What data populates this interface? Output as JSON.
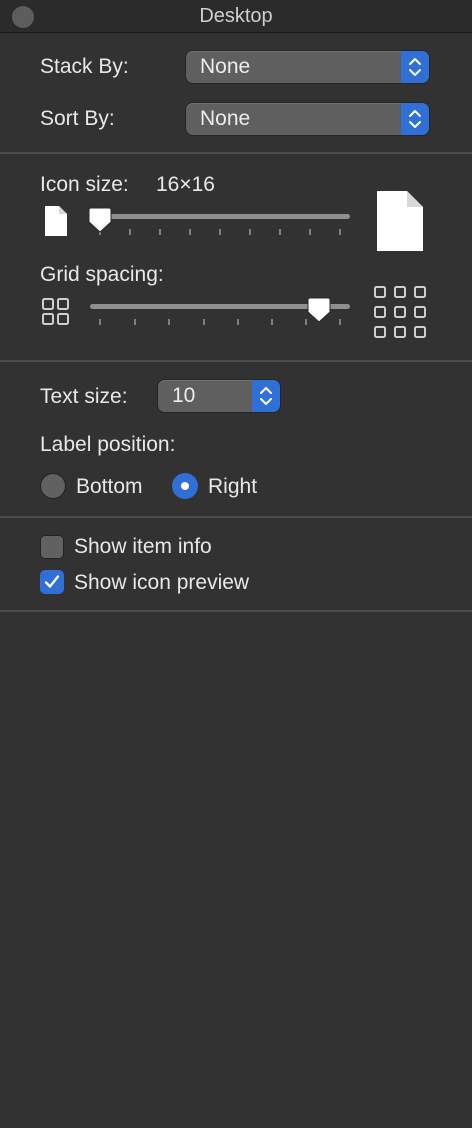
{
  "window": {
    "title": "Desktop"
  },
  "arrangement": {
    "stack_by_label": "Stack By:",
    "stack_by_value": "None",
    "sort_by_label": "Sort By:",
    "sort_by_value": "None"
  },
  "icons": {
    "icon_size_label": "Icon size:",
    "icon_size_value": "16×16",
    "icon_size_slider_fraction": 0.0,
    "grid_spacing_label": "Grid spacing:",
    "grid_spacing_slider_fraction": 0.88
  },
  "text": {
    "text_size_label": "Text size:",
    "text_size_value": "10",
    "label_position_label": "Label position:",
    "options": [
      {
        "label": "Bottom",
        "selected": false
      },
      {
        "label": "Right",
        "selected": true
      }
    ]
  },
  "checkboxes": [
    {
      "label": "Show item info",
      "checked": false
    },
    {
      "label": "Show icon preview",
      "checked": true
    }
  ],
  "colors": {
    "background": "#323232",
    "accent": "#2f6fd6"
  }
}
